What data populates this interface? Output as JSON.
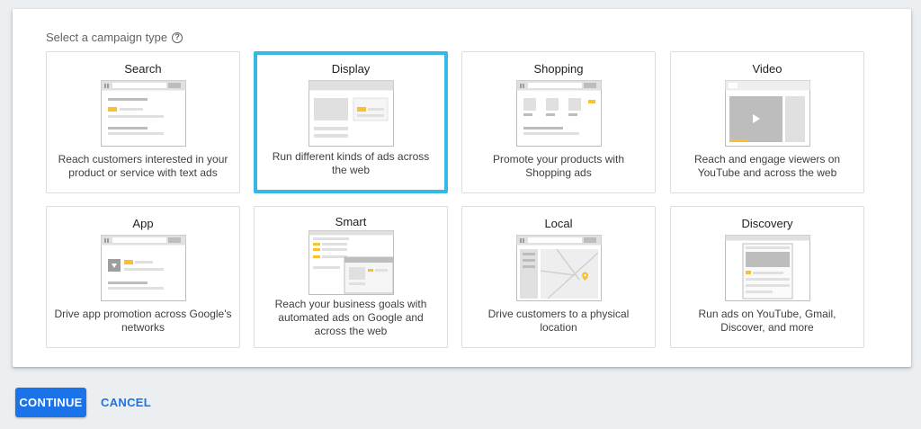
{
  "page": {
    "header_label": "Select a campaign type",
    "help_glyph": "?"
  },
  "campaign_types": [
    {
      "title": "Search",
      "description": "Reach customers interested in your product or service with text ads",
      "selected": false
    },
    {
      "title": "Display",
      "description": "Run different kinds of ads across the web",
      "selected": true
    },
    {
      "title": "Shopping",
      "description": "Promote your products with Shopping ads",
      "selected": false
    },
    {
      "title": "Video",
      "description": "Reach and engage viewers on YouTube and across the web",
      "selected": false
    },
    {
      "title": "App",
      "description": "Drive app promotion across Google's networks",
      "selected": false
    },
    {
      "title": "Smart",
      "description": "Reach your business goals with automated ads on Google and across the web",
      "selected": false
    },
    {
      "title": "Local",
      "description": "Drive customers to a physical location",
      "selected": false
    },
    {
      "title": "Discovery",
      "description": "Run ads on YouTube, Gmail, Discover, and more",
      "selected": false
    }
  ],
  "actions": {
    "continue_label": "CONTINUE",
    "cancel_label": "CANCEL"
  },
  "colors": {
    "selected_border": "#34b8e6",
    "primary": "#1a73e8",
    "accent_yellow": "#fbc02d"
  }
}
